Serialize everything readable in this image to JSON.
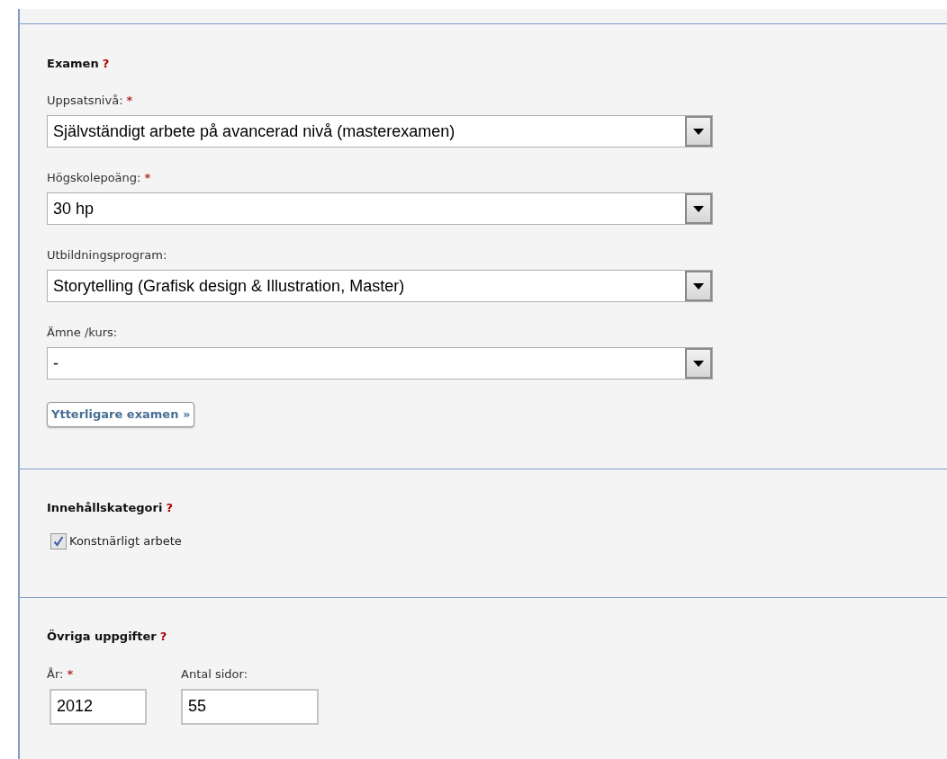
{
  "sections": [
    {
      "kind": "selects",
      "title": "Examen",
      "help": "?",
      "fields": [
        {
          "label": "Uppsatsnivå:",
          "required_mark": "*",
          "value": "Självständigt arbete på avancerad nivå (masterexamen)"
        },
        {
          "label": "Högskolepoäng:",
          "required_mark": "*",
          "value": "30 hp"
        },
        {
          "label": "Utbildningsprogram:",
          "value": "Storytelling (Grafisk design & Illustration, Master)"
        },
        {
          "label": "Ämne /kurs:",
          "value": "-"
        }
      ],
      "button": "Ytterligare examen »"
    },
    {
      "kind": "checkboxes",
      "title": "Innehållskategori",
      "help": "?",
      "checkboxes": [
        {
          "label": "Konstnärligt arbete",
          "checked": true
        }
      ]
    },
    {
      "kind": "inputs",
      "title": "Övriga uppgifter",
      "help": "?",
      "inputs": [
        {
          "label": "År:",
          "required_mark": "*",
          "value": "2012"
        },
        {
          "label": "Antal sidor:",
          "value": "55"
        }
      ]
    }
  ]
}
